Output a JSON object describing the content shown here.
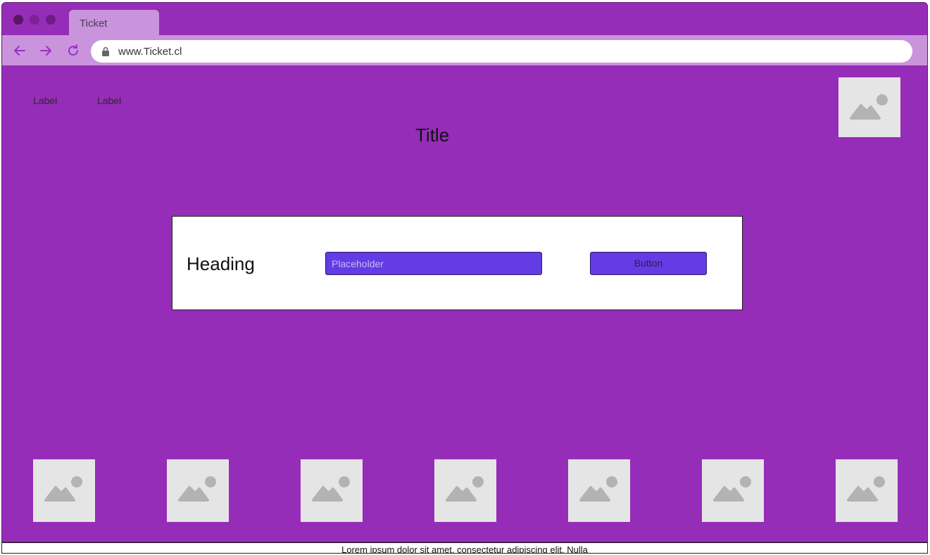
{
  "browser": {
    "tab_title": "Ticket",
    "url": "www.Ticket.cl"
  },
  "icons": {
    "back": "arrow-left-icon",
    "forward": "arrow-right-icon",
    "reload": "reload-icon",
    "lock": "lock-icon",
    "image": "image-placeholder-icon"
  },
  "colors": {
    "page_background": "#962DB8",
    "toolbar": "#C994DC",
    "accent": "#643CE5",
    "placeholder_bg": "#E5E5E5",
    "icon_color": "#9B30C8"
  },
  "header": {
    "labels": [
      "Label",
      "Label"
    ],
    "title": "Title"
  },
  "card": {
    "heading": "Heading",
    "input_placeholder": "Placeholder",
    "button_label": "Button"
  },
  "footer": {
    "text": "Lorem ipsum dolor sit amet, consectetur adipiscing elit. Nulla"
  }
}
